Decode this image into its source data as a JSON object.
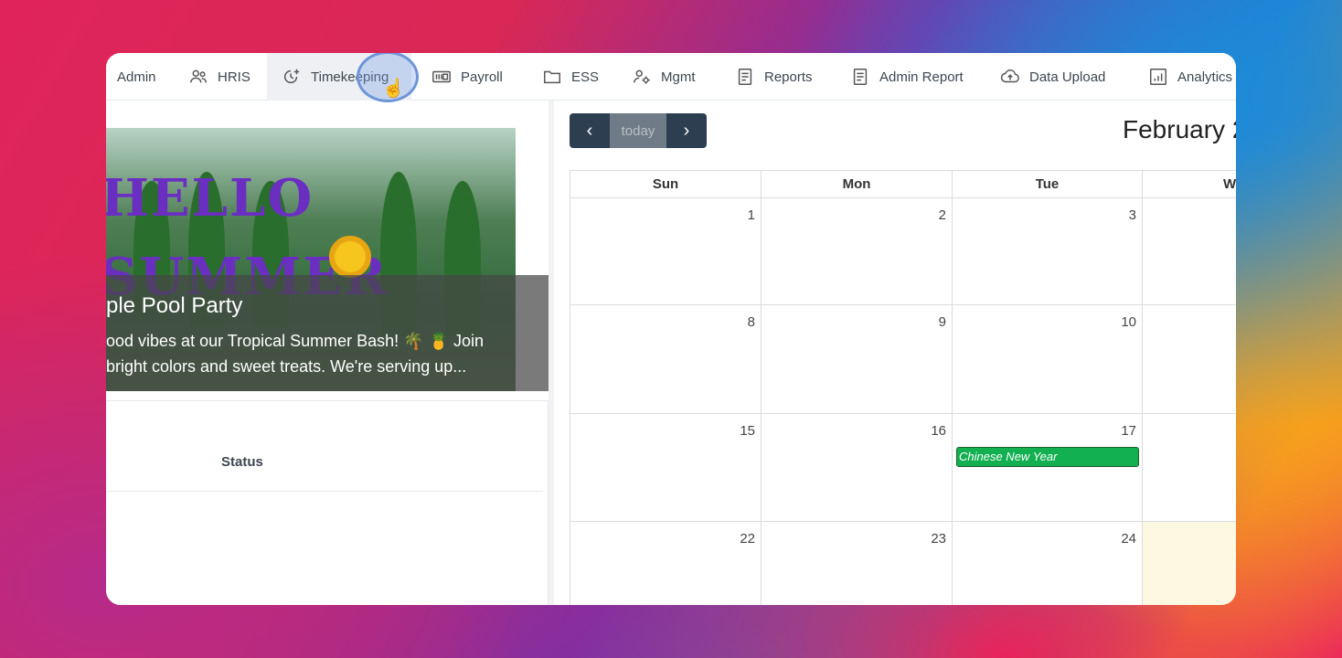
{
  "nav": {
    "items": [
      {
        "label": "Admin",
        "icon": "admin"
      },
      {
        "label": "HRIS",
        "icon": "users-icon"
      },
      {
        "label": "Timekeeping",
        "icon": "clock-plus-icon"
      },
      {
        "label": "Payroll",
        "icon": "payroll-icon"
      },
      {
        "label": "ESS",
        "icon": "folder-icon"
      },
      {
        "label": "Mgmt",
        "icon": "user-gear-icon"
      },
      {
        "label": "Reports",
        "icon": "document-icon"
      },
      {
        "label": "Admin Report",
        "icon": "document-icon"
      },
      {
        "label": "Data Upload",
        "icon": "cloud-upload-icon"
      },
      {
        "label": "Analytics",
        "icon": "chart-icon"
      }
    ],
    "active": "Timekeeping"
  },
  "announcement": {
    "title": "ple Pool Party",
    "line1": "ood vibes at our Tropical Summer Bash! 🌴 🍍 Join",
    "line2": "bright colors and sweet treats. We're serving up...",
    "banner_text": "HELLO SUMMER"
  },
  "table": {
    "status_header": "Status"
  },
  "calendar": {
    "prev_label": "‹",
    "today_label": "today",
    "next_label": "›",
    "title": "February 2",
    "day_headers": [
      "Sun",
      "Mon",
      "Tue",
      "W"
    ],
    "weeks": [
      [
        "1",
        "2",
        "3",
        ""
      ],
      [
        "8",
        "9",
        "10",
        ""
      ],
      [
        "15",
        "16",
        "17",
        ""
      ],
      [
        "22",
        "23",
        "24",
        ""
      ]
    ],
    "event": {
      "label": "Chinese New Year",
      "color": "#12b050"
    },
    "today_highlight": "#fdf8e1"
  }
}
